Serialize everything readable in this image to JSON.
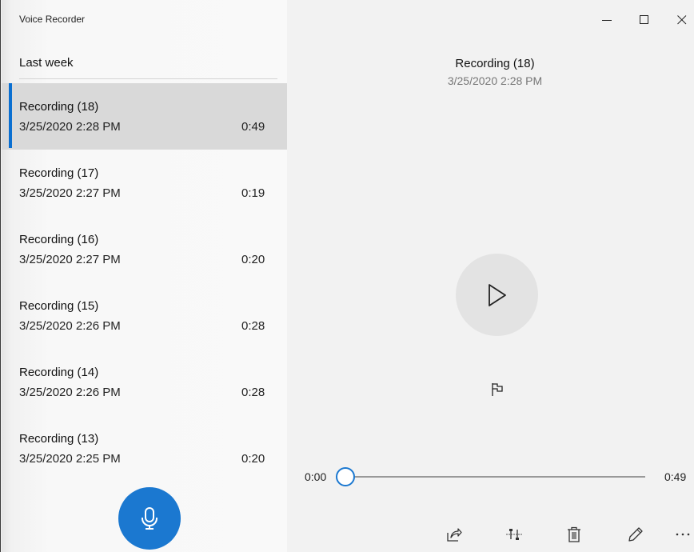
{
  "app": {
    "title": "Voice Recorder"
  },
  "window_controls": {
    "minimize": "minimize-icon",
    "maximize": "maximize-icon",
    "close": "close-icon"
  },
  "list": {
    "group_label": "Last week",
    "items": [
      {
        "name": "Recording (18)",
        "date": "3/25/2020 2:28 PM",
        "duration": "0:49",
        "selected": true
      },
      {
        "name": "Recording (17)",
        "date": "3/25/2020 2:27 PM",
        "duration": "0:19",
        "selected": false
      },
      {
        "name": "Recording (16)",
        "date": "3/25/2020 2:27 PM",
        "duration": "0:20",
        "selected": false
      },
      {
        "name": "Recording (15)",
        "date": "3/25/2020 2:26 PM",
        "duration": "0:28",
        "selected": false
      },
      {
        "name": "Recording (14)",
        "date": "3/25/2020 2:26 PM",
        "duration": "0:28",
        "selected": false
      },
      {
        "name": "Recording (13)",
        "date": "3/25/2020 2:25 PM",
        "duration": "0:20",
        "selected": false
      }
    ]
  },
  "player": {
    "title": "Recording (18)",
    "date": "3/25/2020 2:28 PM",
    "current_time": "0:00",
    "total_time": "0:49",
    "progress": 0
  },
  "toolbar": {
    "icons": [
      "share-icon",
      "trim-icon",
      "delete-icon",
      "rename-icon",
      "more-icon"
    ]
  },
  "colors": {
    "accent": "#1b78d0",
    "selected_bg": "#d9d9d9"
  }
}
